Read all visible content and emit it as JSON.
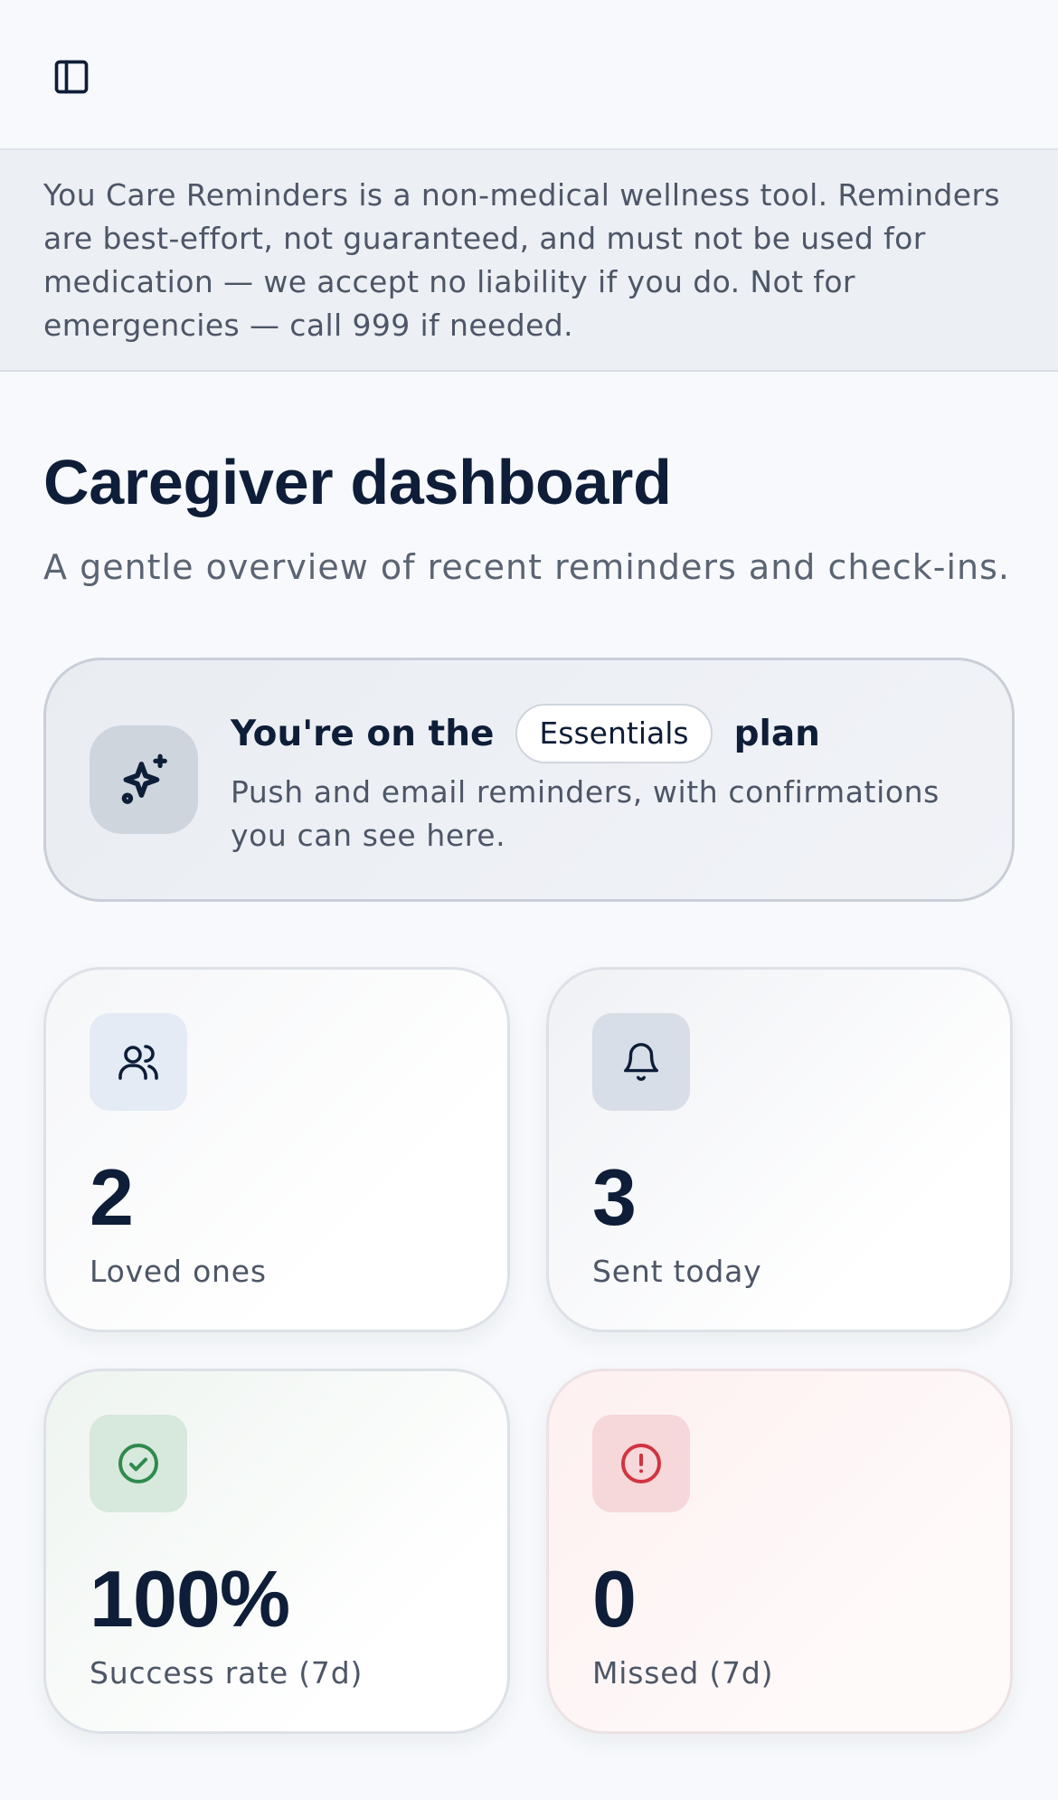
{
  "header": {
    "sidebar_toggle_icon": "sidebar-panel-icon"
  },
  "notice": {
    "text": "You Care Reminders is a non-medical wellness tool. Reminders are best-effort, not guaranteed, and must not be used for medication — we accept no liability if you do. Not for emergencies — call 999 if needed."
  },
  "page": {
    "title": "Caregiver dashboard",
    "subtitle": "A gentle overview of recent reminders and check-ins."
  },
  "plan": {
    "icon": "sparkles-icon",
    "prefix": "You're on the",
    "name": "Essentials",
    "suffix": "plan",
    "description": "Push and email reminders, with confirmations you can see here."
  },
  "stats": [
    {
      "icon": "users-icon",
      "value": "2",
      "label": "Loved ones",
      "icon_bg": "#e4ebf5",
      "icon_color": "#0e1d38"
    },
    {
      "icon": "bell-icon",
      "value": "3",
      "label": "Sent today",
      "icon_bg": "#d8dee7",
      "icon_color": "#0e1d38"
    },
    {
      "icon": "check-circle-icon",
      "value": "100%",
      "label": "Success rate (7d)",
      "icon_bg": "#d7e8dc",
      "icon_color": "#2f8a4e"
    },
    {
      "icon": "alert-circle-icon",
      "value": "0",
      "label": "Missed (7d)",
      "icon_bg": "#f6d7da",
      "icon_color": "#d0353f"
    }
  ]
}
